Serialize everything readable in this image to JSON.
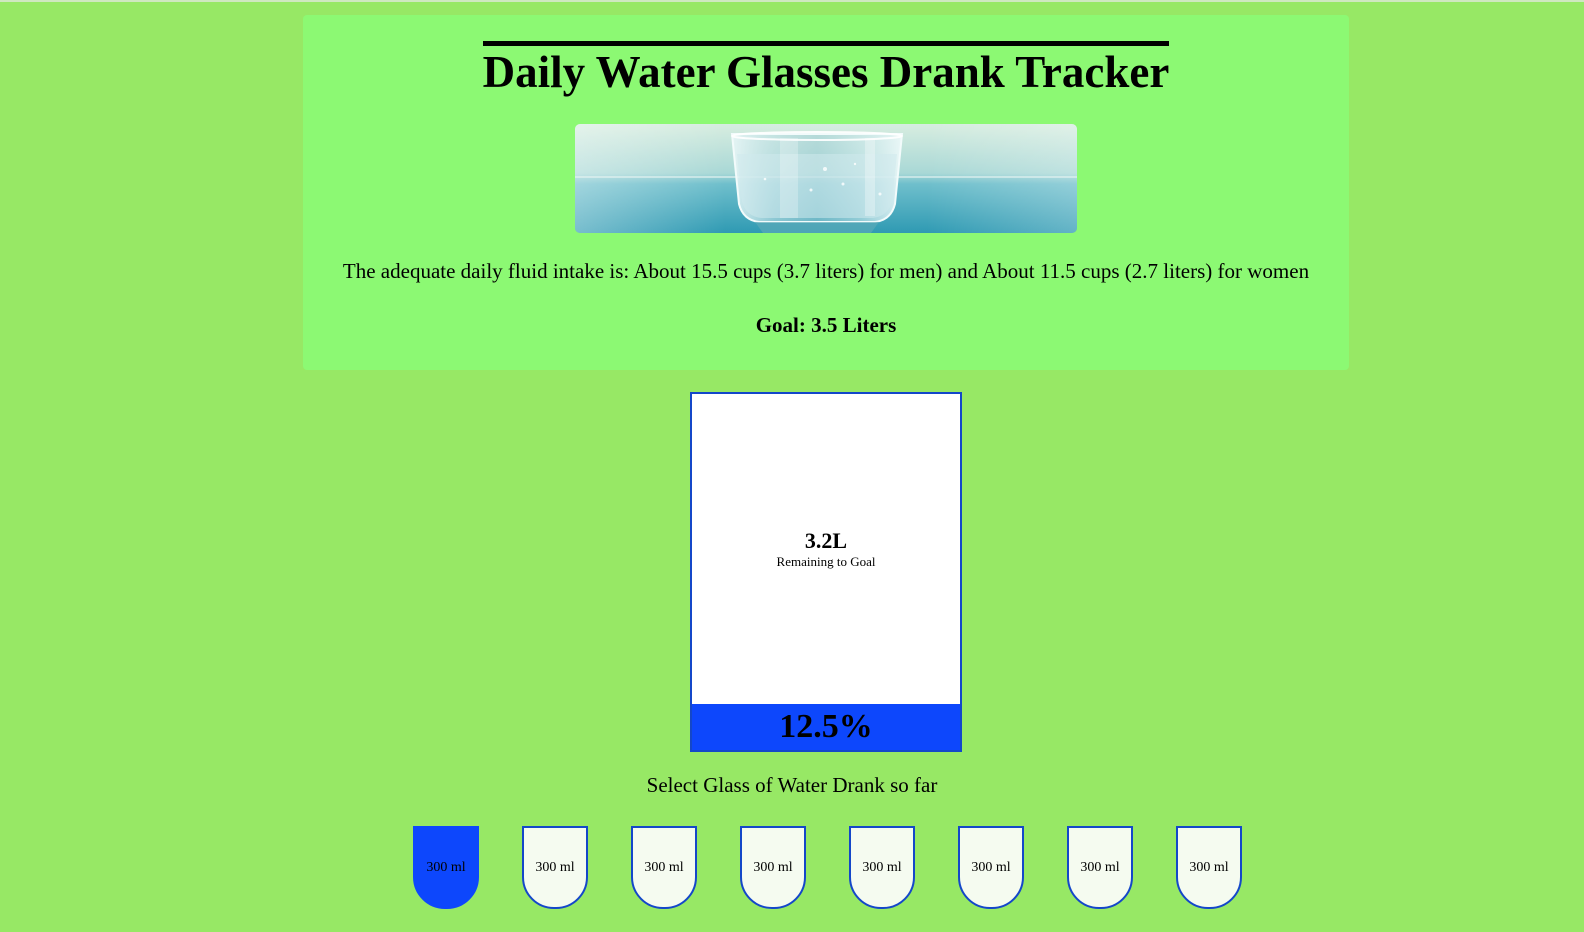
{
  "header": {
    "title": "Daily Water Glasses Drank Tracker",
    "intake_text": "The adequate daily fluid intake is: About 15.5 cups (3.7 liters) for men) and About 11.5 cups (2.7 liters) for women",
    "goal_text": "Goal: 3.5 Liters"
  },
  "tracker": {
    "remaining_amount": "3.2L",
    "remaining_label": "Remaining to Goal",
    "percentage": "12.5%",
    "fill_fraction": 0.125
  },
  "cups_section": {
    "label": "Select Glass of Water Drank so far",
    "cups": [
      {
        "label": "300 ml",
        "full": true
      },
      {
        "label": "300 ml",
        "full": false
      },
      {
        "label": "300 ml",
        "full": false
      },
      {
        "label": "300 ml",
        "full": false
      },
      {
        "label": "300 ml",
        "full": false
      },
      {
        "label": "300 ml",
        "full": false
      },
      {
        "label": "300 ml",
        "full": false
      },
      {
        "label": "300 ml",
        "full": false
      }
    ]
  },
  "colors": {
    "page_background": "#97e865",
    "card_background": "#8cf973",
    "water_blue": "#0d47fc",
    "cup_border": "#1447c9"
  }
}
